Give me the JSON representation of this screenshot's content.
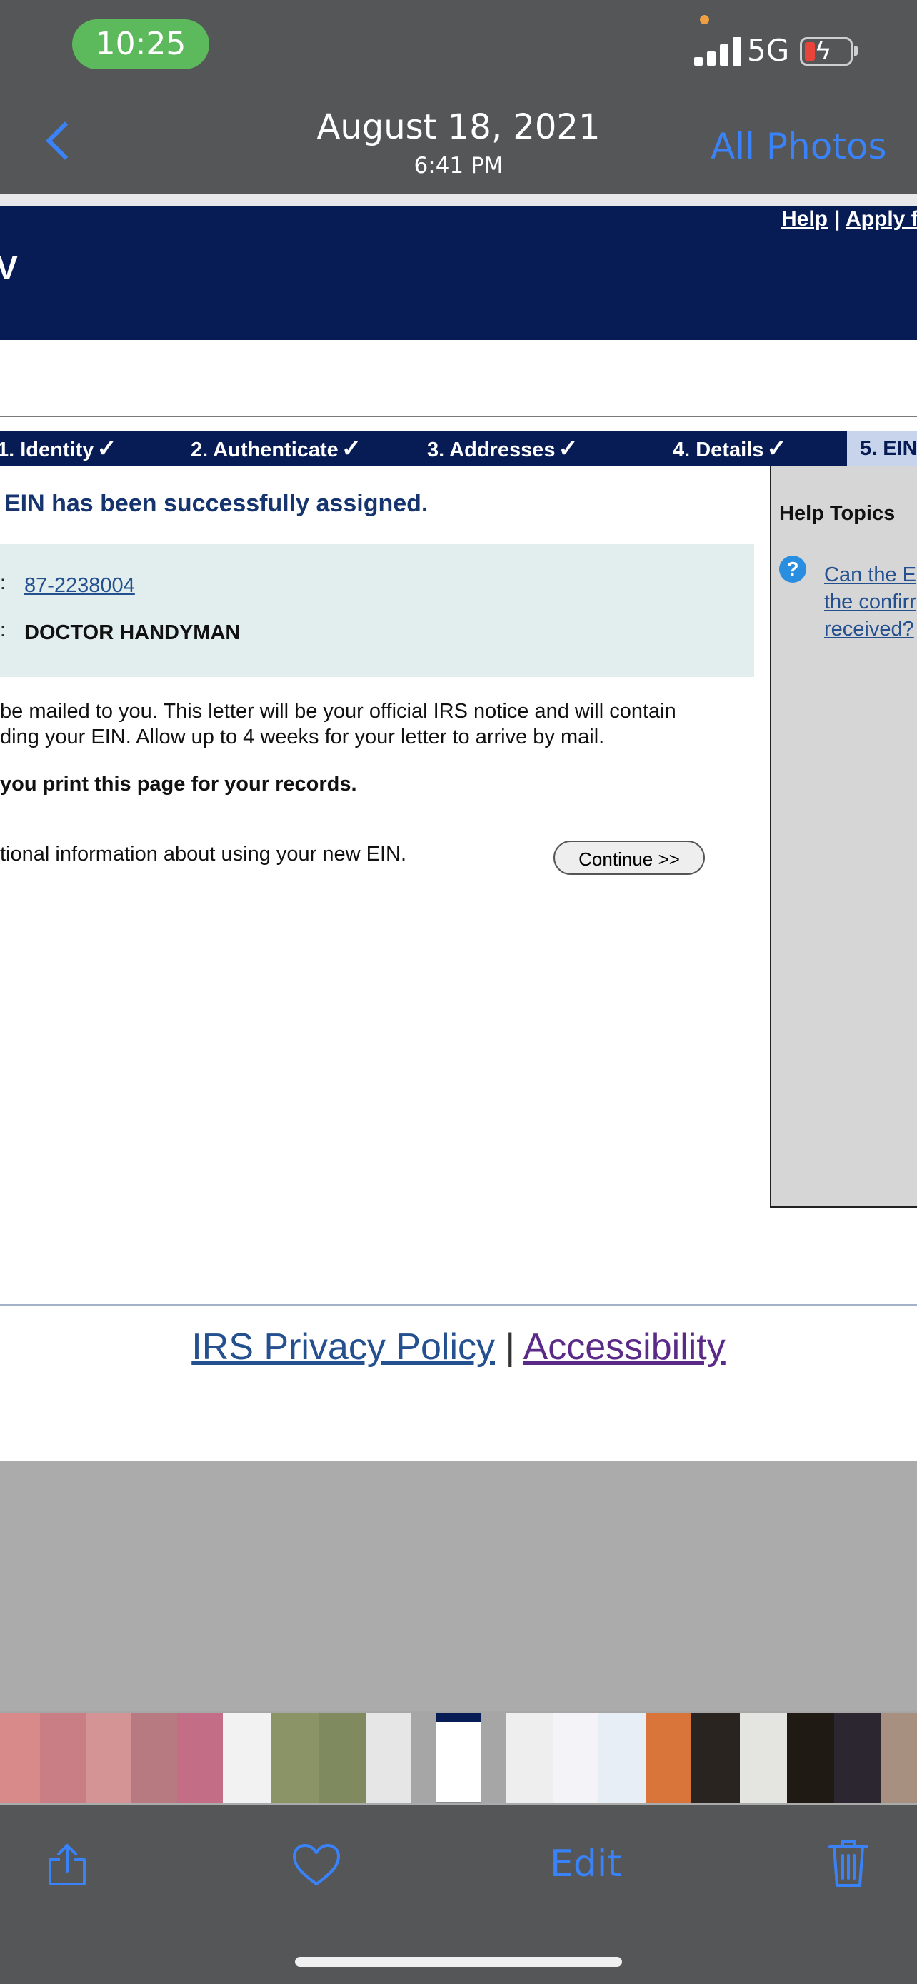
{
  "status_bar": {
    "time": "10:25",
    "network": "5G"
  },
  "nav": {
    "back_icon": "chevron-left-icon",
    "date": "August 18, 2021",
    "time": "6:41 PM",
    "all_photos": "All Photos"
  },
  "irs_page": {
    "top_links": {
      "help": "Help",
      "separator": "|",
      "apply": "Apply f"
    },
    "banner_fragment": "V",
    "steps": [
      {
        "label": "1. Identity",
        "done": true
      },
      {
        "label": "2. Authenticate",
        "done": true
      },
      {
        "label": "3. Addresses",
        "done": true
      },
      {
        "label": "4. Details",
        "done": true
      },
      {
        "label": "5. EIN",
        "done": false
      }
    ],
    "check_glyph": "✓",
    "success_message": "EIN has been successfully assigned.",
    "ein_colon": ":",
    "ein": "87-2238004",
    "name_colon": ":",
    "legal_name": "DOCTOR HANDYMAN",
    "letter_line1": "be mailed to you. This letter will be your official IRS notice and will contain",
    "letter_line2": "ding your EIN. Allow up to 4 weeks for your letter to arrive by mail.",
    "print_notice": "you print this page for your records.",
    "additional_info": "tional information about using your new EIN.",
    "continue_label": "Continue >>",
    "help_panel": {
      "title": "Help Topics",
      "question_icon": "question-mark-icon",
      "question_lines": [
        "Can the E",
        "the confirr",
        "received?"
      ]
    },
    "footer": {
      "privacy": "IRS Privacy Policy",
      "separator": "|",
      "accessibility": "Accessibility"
    }
  },
  "toolbar": {
    "share_icon": "share-icon",
    "favorite_icon": "heart-icon",
    "edit": "Edit",
    "delete_icon": "trash-icon"
  },
  "colors": {
    "accent": "#3a82f7",
    "irs_navy": "#071b55",
    "pill_green": "#5dba5c"
  }
}
